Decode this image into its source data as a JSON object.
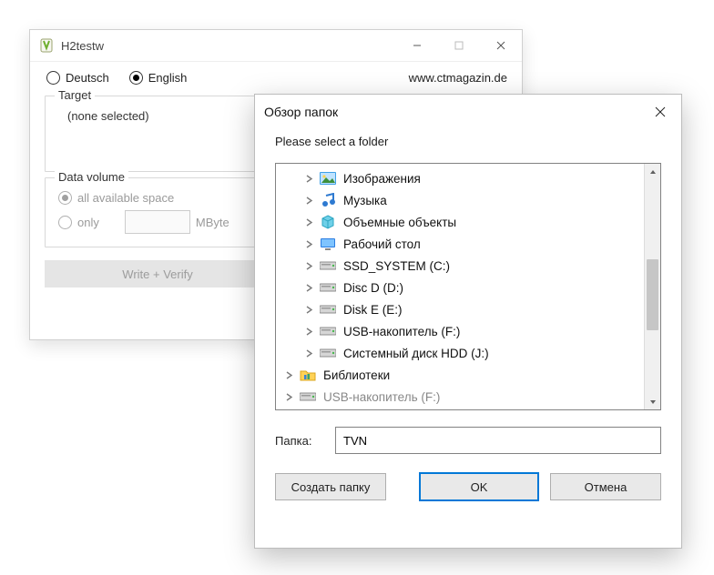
{
  "main": {
    "title": "H2testw",
    "lang": {
      "deutsch": "Deutsch",
      "english": "English",
      "selected": "english"
    },
    "url": "www.ctmagazin.de",
    "target": {
      "legend": "Target",
      "value": "(none selected)"
    },
    "datavol": {
      "legend": "Data volume",
      "all": "all available space",
      "only": "only",
      "unit": "MByte",
      "input_value": ""
    },
    "buttons": {
      "write_verify": "Write + Verify",
      "second": ""
    }
  },
  "browse": {
    "title": "Обзор папок",
    "message": "Please select a folder",
    "tree": [
      {
        "icon": "pictures",
        "label": "Изображения",
        "level": 1,
        "exp": true
      },
      {
        "icon": "music",
        "label": "Музыка",
        "level": 1,
        "exp": true
      },
      {
        "icon": "3d",
        "label": "Объемные объекты",
        "level": 1,
        "exp": true
      },
      {
        "icon": "desktop",
        "label": "Рабочий стол",
        "level": 1,
        "exp": true
      },
      {
        "icon": "drive",
        "label": "SSD_SYSTEM (C:)",
        "level": 1,
        "exp": true
      },
      {
        "icon": "drive",
        "label": "Disc D (D:)",
        "level": 1,
        "exp": true
      },
      {
        "icon": "drive",
        "label": "Disk E (E:)",
        "level": 1,
        "exp": true
      },
      {
        "icon": "drive",
        "label": "USB-накопитель (F:)",
        "level": 1,
        "exp": true
      },
      {
        "icon": "drive",
        "label": "Системный диск HDD (J:)",
        "level": 1,
        "exp": true
      },
      {
        "icon": "libs",
        "label": "Библиотеки",
        "level": 0,
        "exp": true
      },
      {
        "icon": "drive",
        "label": "USB-накопитель (F:)",
        "level": 0,
        "exp": true,
        "cut": true
      }
    ],
    "folder_label": "Папка:",
    "folder_value": "TVN",
    "buttons": {
      "new_folder": "Создать папку",
      "ok": "OK",
      "cancel": "Отмена"
    }
  }
}
